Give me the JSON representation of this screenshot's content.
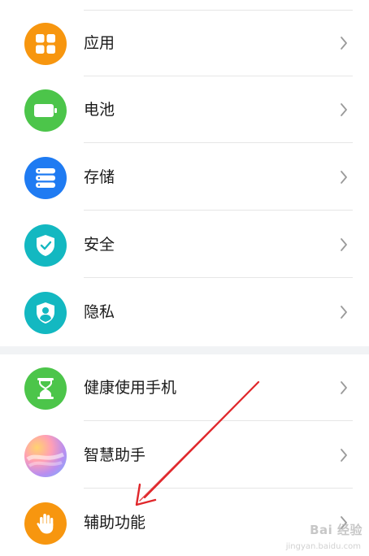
{
  "settings": {
    "items": [
      {
        "label": "应用",
        "icon": "apps-icon",
        "color": "#f7960f"
      },
      {
        "label": "电池",
        "icon": "battery-icon",
        "color": "#4cc54a"
      },
      {
        "label": "存储",
        "icon": "storage-icon",
        "color": "#1f7bf2"
      },
      {
        "label": "安全",
        "icon": "shield-check-icon",
        "color": "#13b8c1"
      },
      {
        "label": "隐私",
        "icon": "privacy-icon",
        "color": "#13b8c1"
      },
      {
        "label": "健康使用手机",
        "icon": "hourglass-icon",
        "color": "#4cc54a"
      },
      {
        "label": "智慧助手",
        "icon": "smart-assistant-icon",
        "color": "#b98ef0"
      },
      {
        "label": "辅助功能",
        "icon": "hand-icon",
        "color": "#f7960f"
      }
    ]
  },
  "watermark": {
    "text": "Bai 经验",
    "sub": "jingyan.baidu.com"
  }
}
